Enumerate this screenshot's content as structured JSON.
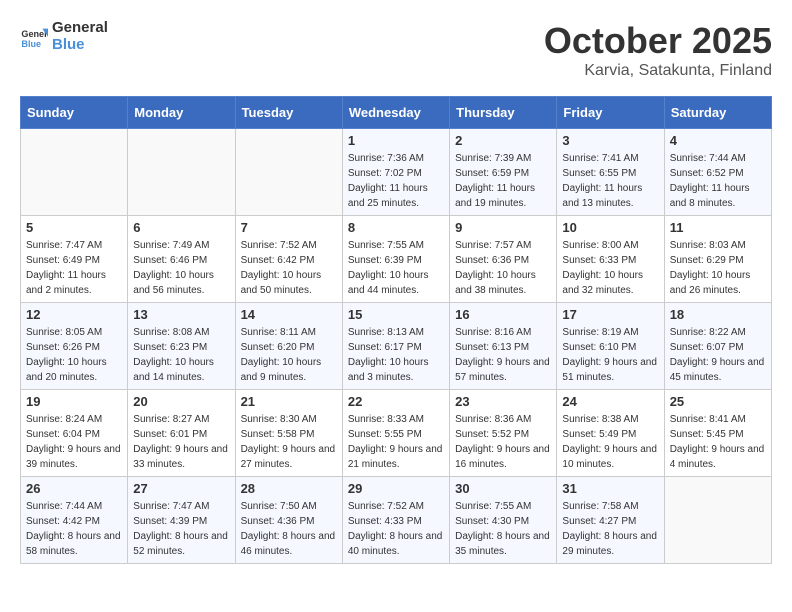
{
  "header": {
    "logo_general": "General",
    "logo_blue": "Blue",
    "month": "October 2025",
    "location": "Karvia, Satakunta, Finland"
  },
  "weekdays": [
    "Sunday",
    "Monday",
    "Tuesday",
    "Wednesday",
    "Thursday",
    "Friday",
    "Saturday"
  ],
  "weeks": [
    [
      {
        "day": "",
        "sunrise": "",
        "sunset": "",
        "daylight": ""
      },
      {
        "day": "",
        "sunrise": "",
        "sunset": "",
        "daylight": ""
      },
      {
        "day": "",
        "sunrise": "",
        "sunset": "",
        "daylight": ""
      },
      {
        "day": "1",
        "sunrise": "Sunrise: 7:36 AM",
        "sunset": "Sunset: 7:02 PM",
        "daylight": "Daylight: 11 hours and 25 minutes."
      },
      {
        "day": "2",
        "sunrise": "Sunrise: 7:39 AM",
        "sunset": "Sunset: 6:59 PM",
        "daylight": "Daylight: 11 hours and 19 minutes."
      },
      {
        "day": "3",
        "sunrise": "Sunrise: 7:41 AM",
        "sunset": "Sunset: 6:55 PM",
        "daylight": "Daylight: 11 hours and 13 minutes."
      },
      {
        "day": "4",
        "sunrise": "Sunrise: 7:44 AM",
        "sunset": "Sunset: 6:52 PM",
        "daylight": "Daylight: 11 hours and 8 minutes."
      }
    ],
    [
      {
        "day": "5",
        "sunrise": "Sunrise: 7:47 AM",
        "sunset": "Sunset: 6:49 PM",
        "daylight": "Daylight: 11 hours and 2 minutes."
      },
      {
        "day": "6",
        "sunrise": "Sunrise: 7:49 AM",
        "sunset": "Sunset: 6:46 PM",
        "daylight": "Daylight: 10 hours and 56 minutes."
      },
      {
        "day": "7",
        "sunrise": "Sunrise: 7:52 AM",
        "sunset": "Sunset: 6:42 PM",
        "daylight": "Daylight: 10 hours and 50 minutes."
      },
      {
        "day": "8",
        "sunrise": "Sunrise: 7:55 AM",
        "sunset": "Sunset: 6:39 PM",
        "daylight": "Daylight: 10 hours and 44 minutes."
      },
      {
        "day": "9",
        "sunrise": "Sunrise: 7:57 AM",
        "sunset": "Sunset: 6:36 PM",
        "daylight": "Daylight: 10 hours and 38 minutes."
      },
      {
        "day": "10",
        "sunrise": "Sunrise: 8:00 AM",
        "sunset": "Sunset: 6:33 PM",
        "daylight": "Daylight: 10 hours and 32 minutes."
      },
      {
        "day": "11",
        "sunrise": "Sunrise: 8:03 AM",
        "sunset": "Sunset: 6:29 PM",
        "daylight": "Daylight: 10 hours and 26 minutes."
      }
    ],
    [
      {
        "day": "12",
        "sunrise": "Sunrise: 8:05 AM",
        "sunset": "Sunset: 6:26 PM",
        "daylight": "Daylight: 10 hours and 20 minutes."
      },
      {
        "day": "13",
        "sunrise": "Sunrise: 8:08 AM",
        "sunset": "Sunset: 6:23 PM",
        "daylight": "Daylight: 10 hours and 14 minutes."
      },
      {
        "day": "14",
        "sunrise": "Sunrise: 8:11 AM",
        "sunset": "Sunset: 6:20 PM",
        "daylight": "Daylight: 10 hours and 9 minutes."
      },
      {
        "day": "15",
        "sunrise": "Sunrise: 8:13 AM",
        "sunset": "Sunset: 6:17 PM",
        "daylight": "Daylight: 10 hours and 3 minutes."
      },
      {
        "day": "16",
        "sunrise": "Sunrise: 8:16 AM",
        "sunset": "Sunset: 6:13 PM",
        "daylight": "Daylight: 9 hours and 57 minutes."
      },
      {
        "day": "17",
        "sunrise": "Sunrise: 8:19 AM",
        "sunset": "Sunset: 6:10 PM",
        "daylight": "Daylight: 9 hours and 51 minutes."
      },
      {
        "day": "18",
        "sunrise": "Sunrise: 8:22 AM",
        "sunset": "Sunset: 6:07 PM",
        "daylight": "Daylight: 9 hours and 45 minutes."
      }
    ],
    [
      {
        "day": "19",
        "sunrise": "Sunrise: 8:24 AM",
        "sunset": "Sunset: 6:04 PM",
        "daylight": "Daylight: 9 hours and 39 minutes."
      },
      {
        "day": "20",
        "sunrise": "Sunrise: 8:27 AM",
        "sunset": "Sunset: 6:01 PM",
        "daylight": "Daylight: 9 hours and 33 minutes."
      },
      {
        "day": "21",
        "sunrise": "Sunrise: 8:30 AM",
        "sunset": "Sunset: 5:58 PM",
        "daylight": "Daylight: 9 hours and 27 minutes."
      },
      {
        "day": "22",
        "sunrise": "Sunrise: 8:33 AM",
        "sunset": "Sunset: 5:55 PM",
        "daylight": "Daylight: 9 hours and 21 minutes."
      },
      {
        "day": "23",
        "sunrise": "Sunrise: 8:36 AM",
        "sunset": "Sunset: 5:52 PM",
        "daylight": "Daylight: 9 hours and 16 minutes."
      },
      {
        "day": "24",
        "sunrise": "Sunrise: 8:38 AM",
        "sunset": "Sunset: 5:49 PM",
        "daylight": "Daylight: 9 hours and 10 minutes."
      },
      {
        "day": "25",
        "sunrise": "Sunrise: 8:41 AM",
        "sunset": "Sunset: 5:45 PM",
        "daylight": "Daylight: 9 hours and 4 minutes."
      }
    ],
    [
      {
        "day": "26",
        "sunrise": "Sunrise: 7:44 AM",
        "sunset": "Sunset: 4:42 PM",
        "daylight": "Daylight: 8 hours and 58 minutes."
      },
      {
        "day": "27",
        "sunrise": "Sunrise: 7:47 AM",
        "sunset": "Sunset: 4:39 PM",
        "daylight": "Daylight: 8 hours and 52 minutes."
      },
      {
        "day": "28",
        "sunrise": "Sunrise: 7:50 AM",
        "sunset": "Sunset: 4:36 PM",
        "daylight": "Daylight: 8 hours and 46 minutes."
      },
      {
        "day": "29",
        "sunrise": "Sunrise: 7:52 AM",
        "sunset": "Sunset: 4:33 PM",
        "daylight": "Daylight: 8 hours and 40 minutes."
      },
      {
        "day": "30",
        "sunrise": "Sunrise: 7:55 AM",
        "sunset": "Sunset: 4:30 PM",
        "daylight": "Daylight: 8 hours and 35 minutes."
      },
      {
        "day": "31",
        "sunrise": "Sunrise: 7:58 AM",
        "sunset": "Sunset: 4:27 PM",
        "daylight": "Daylight: 8 hours and 29 minutes."
      },
      {
        "day": "",
        "sunrise": "",
        "sunset": "",
        "daylight": ""
      }
    ]
  ]
}
